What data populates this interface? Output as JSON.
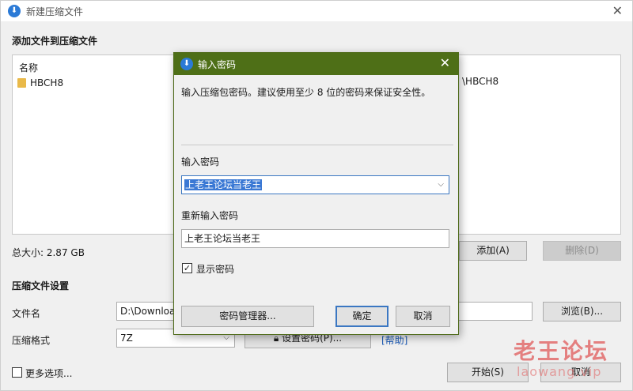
{
  "main": {
    "title": "新建压缩文件",
    "add_files_heading": "添加文件到压缩文件",
    "file_list": {
      "column_name": "名称",
      "rows": [
        {
          "name": "HBCH8"
        }
      ],
      "right_row_text": "\\HBCH8"
    },
    "total_size": "总大小: 2.87 GB",
    "add_button": "添加(A)",
    "delete_button": "删除(D)",
    "settings_heading": "压缩文件设置",
    "filename_label": "文件名",
    "filename_value": "D:\\Downloa",
    "browse_button": "浏览(B)...",
    "format_label": "压缩格式",
    "format_value": "7Z",
    "set_password_button": "设置密码(P)...",
    "help_link": "[帮助]",
    "more_options_label": "更多选项...",
    "start_button": "开始(S)",
    "cancel_button": "取消"
  },
  "dialog": {
    "title": "输入密码",
    "description": "输入压缩包密码。建议使用至少 8 位的密码来保证安全性。",
    "password_label": "输入密码",
    "password_value": "上老王论坛当老王",
    "repeat_label": "重新输入密码",
    "repeat_value": "上老王论坛当老王",
    "show_password_label": "显示密码",
    "show_password_checked": true,
    "manager_button": "密码管理器...",
    "ok_button": "确定",
    "cancel_button": "取消"
  },
  "watermark": {
    "text": "老王论坛",
    "sub": "laowang.vip",
    "color": "#e26c6c"
  },
  "colors": {
    "dialog_titlebar": "#4e6f17",
    "accent": "#3b77c2"
  }
}
